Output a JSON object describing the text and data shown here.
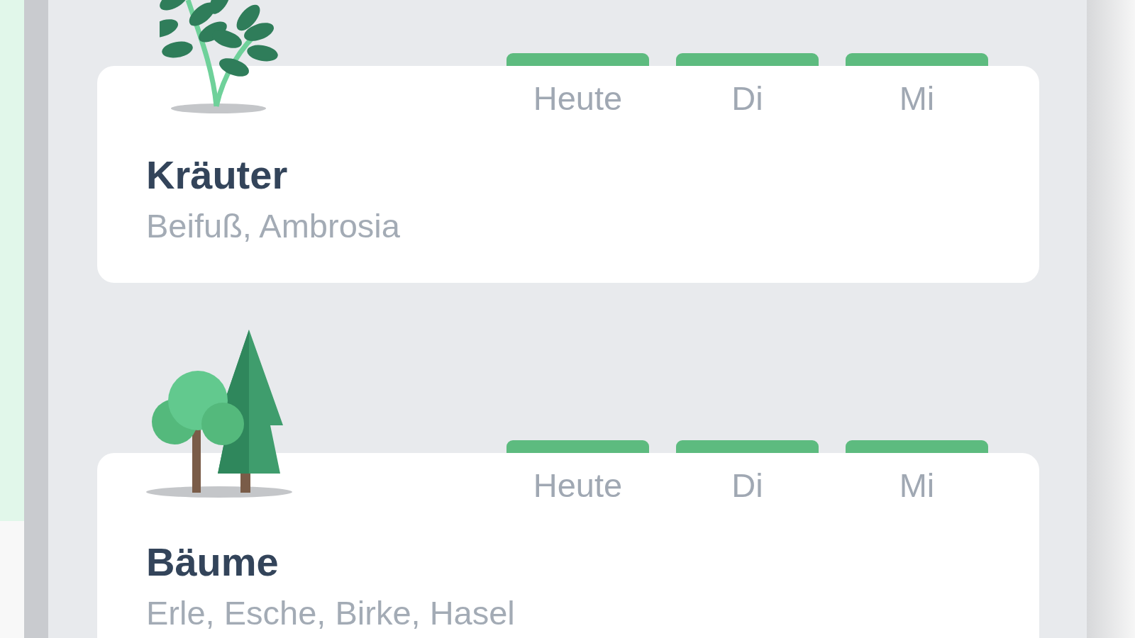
{
  "sections": [
    {
      "kind": "herb",
      "title": "Kräuter",
      "subtitle": "Beifuß, Ambrosia",
      "days": [
        {
          "label": "Heute",
          "color": "#5dbb7f"
        },
        {
          "label": "Di",
          "color": "#5dbb7f"
        },
        {
          "label": "Mi",
          "color": "#5dbb7f"
        }
      ]
    },
    {
      "kind": "tree",
      "title": "Bäume",
      "subtitle": "Erle, Esche, Birke, Hasel",
      "days": [
        {
          "label": "Heute",
          "color": "#5dbb7f"
        },
        {
          "label": "Di",
          "color": "#5dbb7f"
        },
        {
          "label": "Mi",
          "color": "#5dbb7f"
        }
      ]
    }
  ]
}
